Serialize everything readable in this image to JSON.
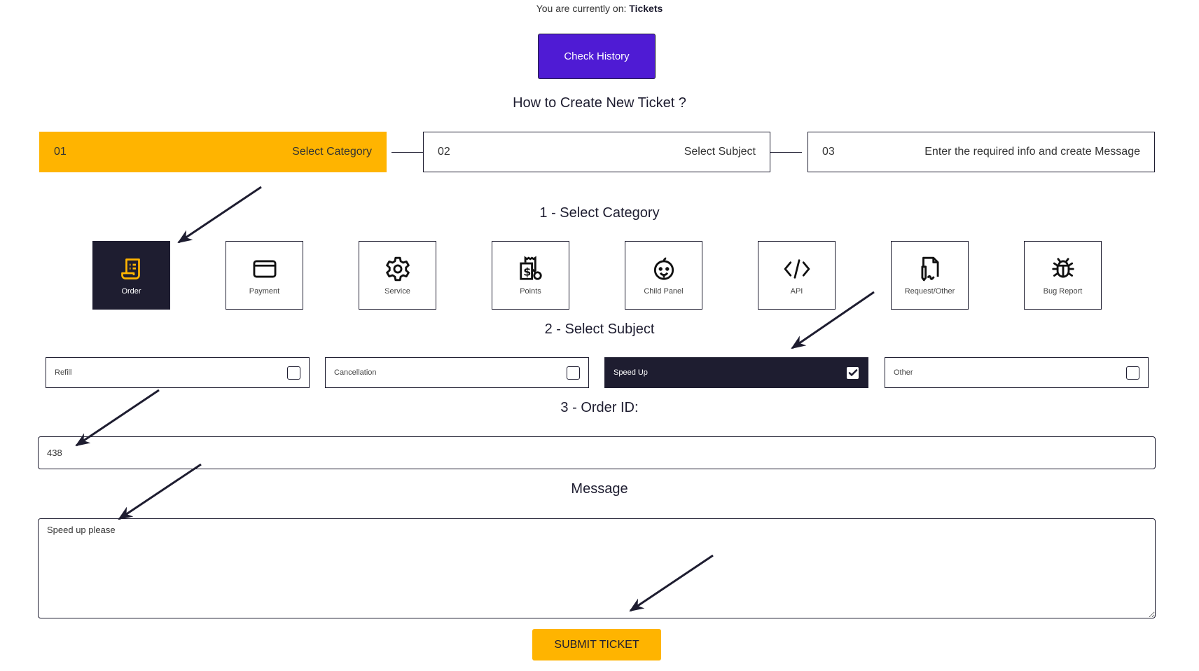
{
  "location": {
    "prefix": "You are currently on:",
    "page": "Tickets"
  },
  "check_history_label": "Check History",
  "how_title": "How to Create New Ticket ?",
  "steps": [
    {
      "number": "01",
      "label": "Select Category",
      "active": true
    },
    {
      "number": "02",
      "label": "Select Subject",
      "active": false
    },
    {
      "number": "03",
      "label": "Enter the required info and create Message",
      "active": false
    }
  ],
  "section1_title": "1 - Select Category",
  "categories": [
    {
      "label": "Order",
      "icon": "receipt-icon",
      "active": true
    },
    {
      "label": "Payment",
      "icon": "credit-card-icon",
      "active": false
    },
    {
      "label": "Service",
      "icon": "gear-icon",
      "active": false
    },
    {
      "label": "Points",
      "icon": "dollar-receipt-icon",
      "active": false
    },
    {
      "label": "Child Panel",
      "icon": "baby-face-icon",
      "active": false
    },
    {
      "label": "API",
      "icon": "code-icon",
      "active": false
    },
    {
      "label": "Request/Other",
      "icon": "document-sign-icon",
      "active": false
    },
    {
      "label": "Bug Report",
      "icon": "bug-icon",
      "active": false
    }
  ],
  "section2_title": "2 - Select Subject",
  "subjects": [
    {
      "label": "Refill",
      "checked": false
    },
    {
      "label": "Cancellation",
      "checked": false
    },
    {
      "label": "Speed Up",
      "checked": true
    },
    {
      "label": "Other",
      "checked": false
    }
  ],
  "section3_title": "3 - Order ID:",
  "order_id_value": "438",
  "message_title": "Message",
  "message_value": "Speed up please",
  "submit_label": "SUBMIT TICKET",
  "colors": {
    "accent_yellow": "#ffb400",
    "accent_purple": "#4f1bd4",
    "dark": "#1e1d30"
  }
}
